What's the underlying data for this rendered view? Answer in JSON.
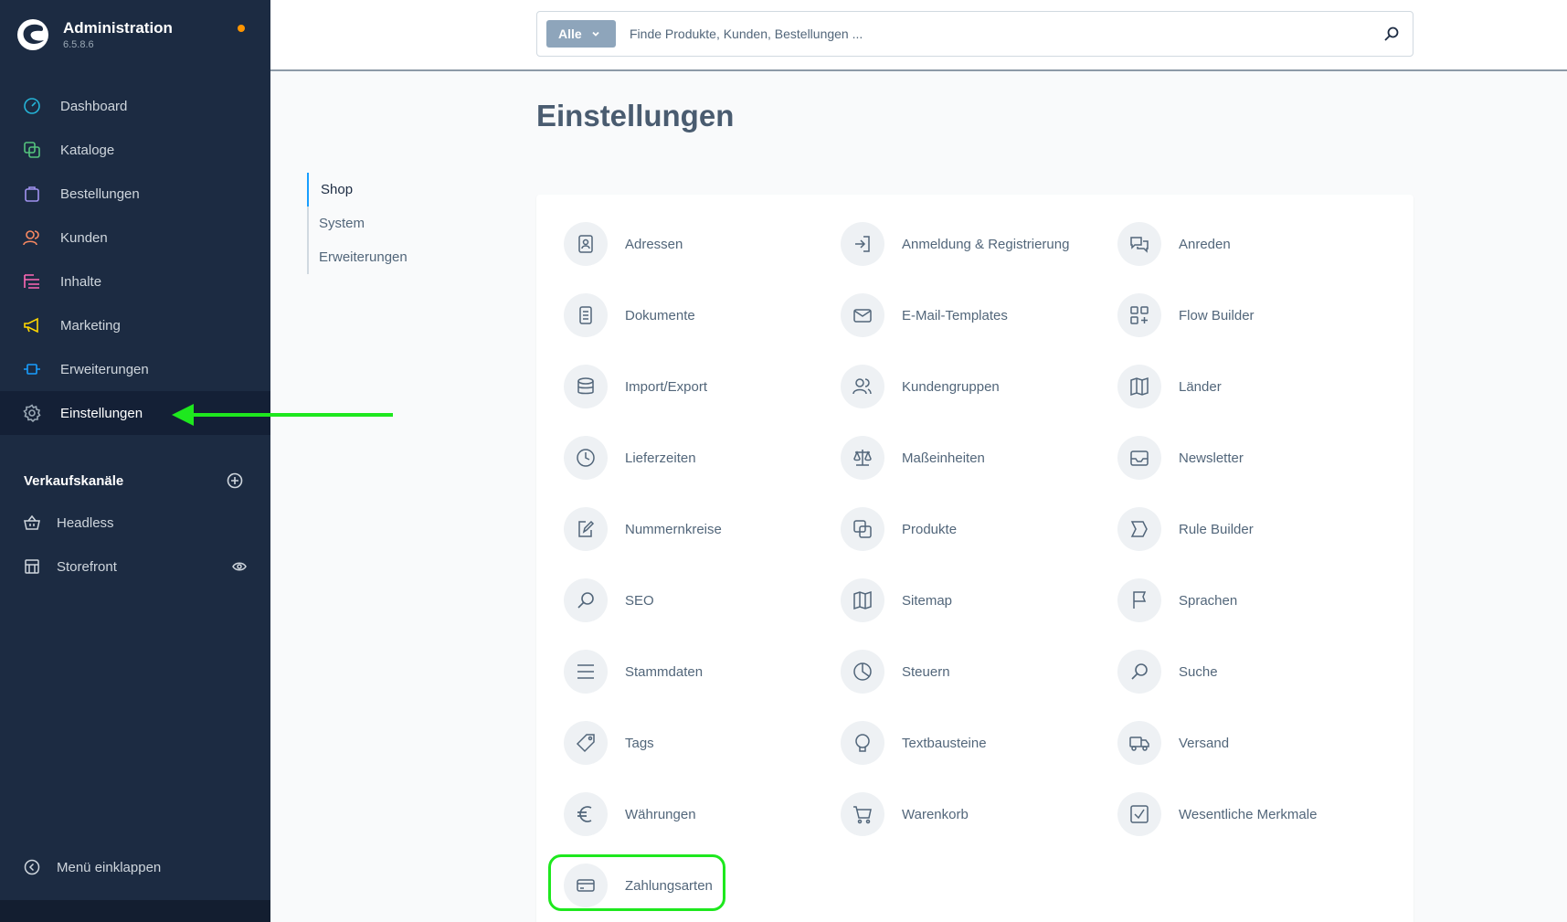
{
  "brand": {
    "title": "Administration",
    "version": "6.5.8.6",
    "accent_dot_color": "#ff9500"
  },
  "sidebar": {
    "items": [
      {
        "label": "Dashboard",
        "icon": "dashboard-icon",
        "color": "#25b4d7"
      },
      {
        "label": "Kataloge",
        "icon": "catalog-icon",
        "color": "#54c37d"
      },
      {
        "label": "Bestellungen",
        "icon": "orders-icon",
        "color": "#a092f0"
      },
      {
        "label": "Kunden",
        "icon": "customers-icon",
        "color": "#f88962"
      },
      {
        "label": "Inhalte",
        "icon": "content-icon",
        "color": "#ff68b4"
      },
      {
        "label": "Marketing",
        "icon": "marketing-icon",
        "color": "#ffd700"
      },
      {
        "label": "Erweiterungen",
        "icon": "extensions-icon",
        "color": "#189eff"
      },
      {
        "label": "Einstellungen",
        "icon": "settings-icon",
        "color": "#9aa8b5",
        "active": true
      }
    ],
    "channels_title": "Verkaufskanäle",
    "channels": [
      {
        "label": "Headless",
        "icon": "basket-icon"
      },
      {
        "label": "Storefront",
        "icon": "storefront-icon",
        "right_icon": "eye-icon"
      }
    ],
    "collapse_label": "Menü einklappen"
  },
  "search": {
    "type_label": "Alle",
    "placeholder": "Finde Produkte, Kunden, Bestellungen ..."
  },
  "page": {
    "title": "Einstellungen"
  },
  "subnav": [
    {
      "label": "Shop",
      "active": true
    },
    {
      "label": "System"
    },
    {
      "label": "Erweiterungen"
    }
  ],
  "settings": [
    {
      "label": "Adressen",
      "icon": "address-book-icon"
    },
    {
      "label": "Anmeldung & Registrierung",
      "icon": "sign-in-icon"
    },
    {
      "label": "Anreden",
      "icon": "chat-bubbles-icon"
    },
    {
      "label": "Dokumente",
      "icon": "document-icon"
    },
    {
      "label": "E-Mail-Templates",
      "icon": "envelope-icon"
    },
    {
      "label": "Flow Builder",
      "icon": "flow-icon"
    },
    {
      "label": "Import/Export",
      "icon": "database-icon"
    },
    {
      "label": "Kundengruppen",
      "icon": "users-icon"
    },
    {
      "label": "Länder",
      "icon": "map-icon"
    },
    {
      "label": "Lieferzeiten",
      "icon": "clock-icon"
    },
    {
      "label": "Maßeinheiten",
      "icon": "scale-icon"
    },
    {
      "label": "Newsletter",
      "icon": "inbox-icon"
    },
    {
      "label": "Nummernkreise",
      "icon": "edit-document-icon"
    },
    {
      "label": "Produkte",
      "icon": "products-icon"
    },
    {
      "label": "Rule Builder",
      "icon": "rule-icon"
    },
    {
      "label": "SEO",
      "icon": "search-icon"
    },
    {
      "label": "Sitemap",
      "icon": "sitemap-icon"
    },
    {
      "label": "Sprachen",
      "icon": "flag-icon"
    },
    {
      "label": "Stammdaten",
      "icon": "list-icon"
    },
    {
      "label": "Steuern",
      "icon": "pie-icon"
    },
    {
      "label": "Suche",
      "icon": "search-icon"
    },
    {
      "label": "Tags",
      "icon": "tag-icon"
    },
    {
      "label": "Textbausteine",
      "icon": "speech-icon"
    },
    {
      "label": "Versand",
      "icon": "truck-icon"
    },
    {
      "label": "Währungen",
      "icon": "euro-icon"
    },
    {
      "label": "Warenkorb",
      "icon": "cart-icon"
    },
    {
      "label": "Wesentliche Merkmale",
      "icon": "checkbox-icon"
    },
    {
      "label": "Zahlungsarten",
      "icon": "credit-card-icon",
      "highlighted": true
    }
  ],
  "annotation_color": "#1ee81e"
}
